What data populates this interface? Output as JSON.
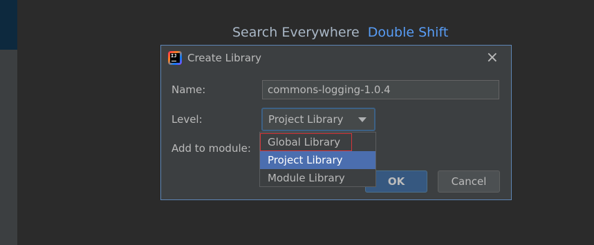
{
  "background": {
    "search_hint": {
      "label": "Search Everywhere",
      "shortcut": "Double Shift"
    }
  },
  "dialog": {
    "title": "Create Library",
    "icon": "intellij-idea-icon",
    "icon_text": "IJ",
    "close_icon": "×",
    "fields": {
      "name_label": "Name:",
      "name_value": "commons-logging-1.0.4",
      "level_label": "Level:",
      "level_value": "Project Library",
      "module_label": "Add to module:"
    },
    "buttons": {
      "ok": "OK",
      "cancel": "Cancel"
    }
  },
  "level_dropdown": {
    "options": [
      "Global Library",
      "Project Library",
      "Module Library"
    ],
    "selected": "Project Library",
    "highlighted_outline": "Global Library"
  },
  "colors": {
    "accent": "#4b6eaf",
    "link": "#589df6",
    "annotation_outline": "#d7363a",
    "dialog_border": "#5e87b8"
  }
}
